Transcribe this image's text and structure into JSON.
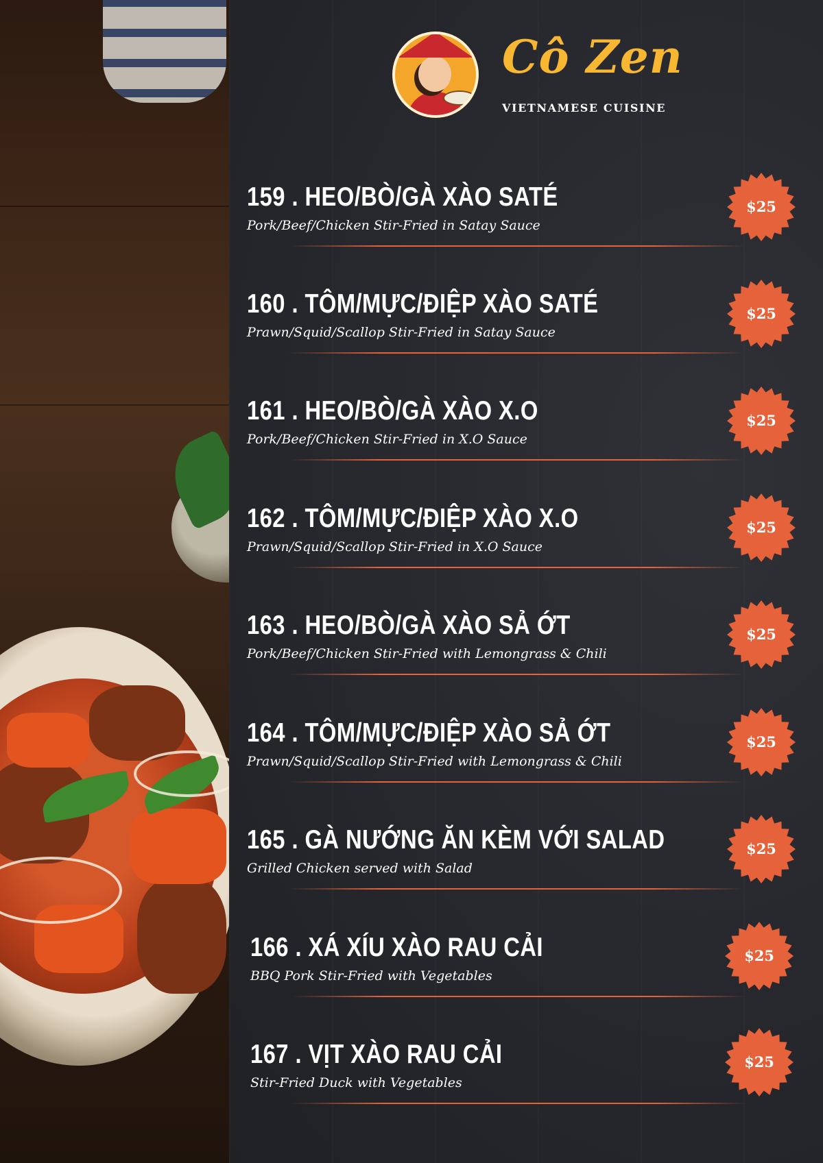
{
  "brand": {
    "name": "Cô Zen",
    "tagline": "VIETNAMESE CUISINE",
    "emblem": "chef-woman-logo"
  },
  "colors": {
    "background": "#25272c",
    "accent": "#e6623b",
    "brand": "#f7b733",
    "text": "#ffffff"
  },
  "menu": {
    "items": [
      {
        "number": "159",
        "name": "159 . HEO/BÒ/GÀ XÀO SATÉ",
        "description": "Pork/Beef/Chicken Stir-Fried in Satay Sauce",
        "price": "$25"
      },
      {
        "number": "160",
        "name": "160 . TÔM/MỰC/ĐIỆP XÀO SATÉ",
        "description": "Prawn/Squid/Scallop Stir-Fried in Satay Sauce",
        "price": "$25"
      },
      {
        "number": "161",
        "name": "161 . HEO/BÒ/GÀ XÀO X.O",
        "description": "Pork/Beef/Chicken Stir-Fried in X.O Sauce",
        "price": "$25"
      },
      {
        "number": "162",
        "name": "162 . TÔM/MỰC/ĐIỆP XÀO X.O",
        "description": "Prawn/Squid/Scallop Stir-Fried in X.O Sauce",
        "price": "$25"
      },
      {
        "number": "163",
        "name": "163 . HEO/BÒ/GÀ XÀO SẢ ỚT",
        "description": "Pork/Beef/Chicken Stir-Fried with Lemongrass & Chili",
        "price": "$25"
      },
      {
        "number": "164",
        "name": "164 . TÔM/MỰC/ĐIỆP XÀO SẢ ỚT",
        "description": "Prawn/Squid/Scallop Stir-Fried with Lemongrass & Chili",
        "price": "$25"
      },
      {
        "number": "165",
        "name": "165 . GÀ NƯỚNG ĂN KÈM VỚI SALAD",
        "description": "Grilled Chicken served with Salad",
        "price": "$25"
      },
      {
        "number": "166",
        "name": "166 . XÁ XÍU XÀO RAU CẢI",
        "description": "BBQ Pork Stir-Fried with Vegetables",
        "price": "$25"
      },
      {
        "number": "167",
        "name": "167 . VỊT XÀO RAU CẢI",
        "description": "Stir-Fried Duck with Vegetables",
        "price": "$25"
      }
    ]
  }
}
